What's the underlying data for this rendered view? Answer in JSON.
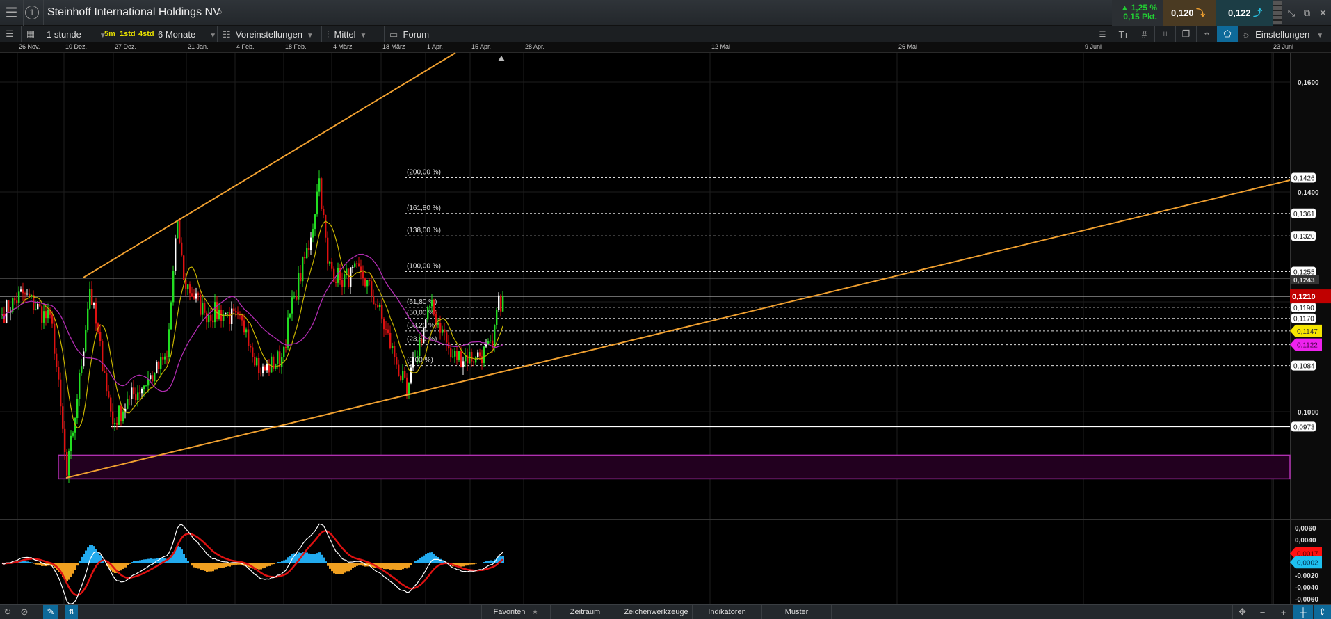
{
  "header": {
    "title": "Steinhoff International Holdings NV",
    "window_number": "1",
    "change_pct": "▲ 1,25 %",
    "change_pts": "0,15 Pkt.",
    "bid": "0,120",
    "ask": "0,122"
  },
  "toolbar": {
    "interval": "1 stunde",
    "quick_5m": "5m",
    "quick_1std": "1std",
    "quick_4std": "4std",
    "range": "6 Monate",
    "presets": "Voreinstellungen",
    "chart_type": "Mittel",
    "forum": "Forum",
    "settings": "Einstellungen"
  },
  "bottom": {
    "favorites": "Favoriten",
    "timerange": "Zeitraum",
    "drawing_tools": "Zeichenwerkzeuge",
    "indicators": "Indikatoren",
    "patterns": "Muster"
  },
  "colors": {
    "up": "#22dd22",
    "down": "#dd1111",
    "ma_fast": "#c8b400",
    "ma_slow": "#b02cb0",
    "trend": "#f0a030",
    "zone": "#b030b0",
    "last": "#c00000"
  },
  "chart_data": {
    "type": "candlestick",
    "title": "Steinhoff International Holdings NV",
    "x_ticks": [
      "26 Nov.",
      "10 Dez.",
      "27 Dez.",
      "21 Jan.",
      "4 Feb.",
      "18 Feb.",
      "4 März",
      "18 März",
      "1 Apr.",
      "15 Apr.",
      "28 Apr.",
      "12 Mai",
      "26 Mai",
      "9 Juni",
      "23 Juni"
    ],
    "y_ticks": [
      "0,1600",
      "0,1400",
      "0,1000"
    ],
    "y_tick_values": [
      0.16,
      0.14,
      0.1
    ],
    "ylim": [
      0.085,
      0.165
    ],
    "price_path": [
      [
        0,
        0.1178
      ],
      [
        10,
        0.1216
      ],
      [
        24,
        0.116
      ],
      [
        31,
        0.0884
      ],
      [
        36,
        0.1023
      ],
      [
        42,
        0.1224
      ],
      [
        49,
        0.107
      ],
      [
        53,
        0.0977
      ],
      [
        61,
        0.1023
      ],
      [
        73,
        0.107
      ],
      [
        79,
        0.11
      ],
      [
        84,
        0.1348
      ],
      [
        87,
        0.124
      ],
      [
        97,
        0.118
      ],
      [
        107,
        0.118
      ],
      [
        117,
        0.115
      ],
      [
        124,
        0.107
      ],
      [
        134,
        0.11
      ],
      [
        140,
        0.121
      ],
      [
        148,
        0.1317
      ],
      [
        152,
        0.1425
      ],
      [
        156,
        0.127
      ],
      [
        162,
        0.124
      ],
      [
        172,
        0.1255
      ],
      [
        180,
        0.119
      ],
      [
        188,
        0.11
      ],
      [
        194,
        0.1031
      ],
      [
        198,
        0.11
      ],
      [
        205,
        0.1192
      ],
      [
        211,
        0.115
      ],
      [
        215,
        0.11
      ],
      [
        227,
        0.11
      ],
      [
        235,
        0.1115
      ],
      [
        237,
        0.1185
      ],
      [
        240,
        0.121
      ]
    ],
    "fibonacci": [
      {
        "label": "(200,00 %)",
        "value": 0.1426,
        "tag": "0,1426"
      },
      {
        "label": "(161,80 %)",
        "value": 0.1361,
        "tag": "0,1361"
      },
      {
        "label": "(138,00 %)",
        "value": 0.132,
        "tag": "0,1320"
      },
      {
        "label": "(100,00 %)",
        "value": 0.1255,
        "tag": "0,1255"
      },
      {
        "label": "(61,80 %)",
        "value": 0.119,
        "tag": "0,1190"
      },
      {
        "label": "(50,00 %)",
        "value": 0.117,
        "tag": "0,1170"
      },
      {
        "label": "(38,20 %)",
        "value": 0.1147,
        "tag": ""
      },
      {
        "label": "(23,60 %)",
        "value": 0.1122,
        "tag": ""
      },
      {
        "label": "(0,00 %)",
        "value": 0.1084,
        "tag": "0,1084"
      }
    ],
    "levels": {
      "resistance": {
        "value": 0.1243,
        "tag": "0,1243"
      },
      "last": {
        "value": 0.121,
        "tag": "0,1210"
      },
      "support": {
        "value": 0.0973,
        "tag": "0,0973"
      }
    },
    "ma_tags": {
      "fast": {
        "value": 0.1147,
        "tag": "0,1147"
      },
      "slow": {
        "value": 0.1122,
        "tag": "0,1122"
      }
    },
    "zone": [
      0.0878,
      0.0921
    ],
    "oscillator": {
      "y_ticks": [
        "0,0060",
        "0,0040",
        "-0,0020",
        "-0,0040",
        "-0,0060"
      ],
      "y_tick_values": [
        0.006,
        0.004,
        -0.002,
        -0.004,
        -0.006
      ],
      "macd_tag": "0,0017",
      "signal_tag": "0,0002",
      "macd": 0.0017,
      "signal": 0.0002
    }
  }
}
